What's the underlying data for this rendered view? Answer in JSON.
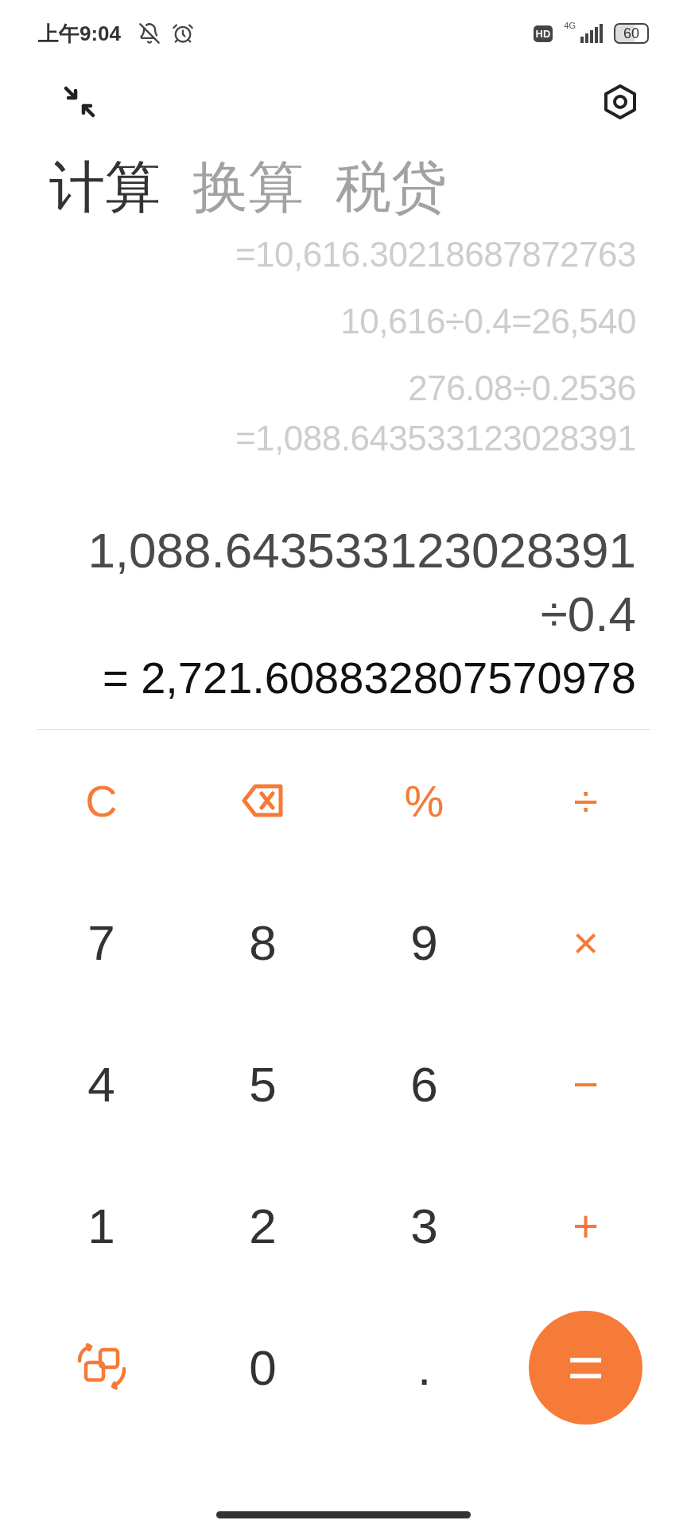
{
  "status_bar": {
    "time": "上午9:04",
    "hd_badge": "HD",
    "network": "4G",
    "battery": "60"
  },
  "tabs": [
    {
      "label": "计算",
      "selected": true
    },
    {
      "label": "换算",
      "selected": false
    },
    {
      "label": "税贷",
      "selected": false
    }
  ],
  "history": [
    {
      "lines": [
        "=10,616.30218687872763"
      ]
    },
    {
      "lines": [
        "10,616÷0.4=26,540"
      ]
    },
    {
      "lines": [
        "276.08÷0.2536",
        "=1,088.643533123028391"
      ]
    }
  ],
  "expression": [
    "1,088.643533123028391",
    "÷0.4"
  ],
  "result": "= 2,721.608832807570978",
  "keys": [
    {
      "kind": "clear",
      "label": "C"
    },
    {
      "kind": "backspace"
    },
    {
      "kind": "operator",
      "label": "%"
    },
    {
      "kind": "operator",
      "label": "÷"
    },
    {
      "kind": "digit",
      "label": "7"
    },
    {
      "kind": "digit",
      "label": "8"
    },
    {
      "kind": "digit",
      "label": "9"
    },
    {
      "kind": "operator",
      "label": "×"
    },
    {
      "kind": "digit",
      "label": "4"
    },
    {
      "kind": "digit",
      "label": "5"
    },
    {
      "kind": "digit",
      "label": "6"
    },
    {
      "kind": "operator",
      "label": "−"
    },
    {
      "kind": "digit",
      "label": "1"
    },
    {
      "kind": "digit",
      "label": "2"
    },
    {
      "kind": "digit",
      "label": "3"
    },
    {
      "kind": "operator",
      "label": "+"
    },
    {
      "kind": "swap"
    },
    {
      "kind": "digit",
      "label": "0"
    },
    {
      "kind": "digit",
      "label": "."
    },
    {
      "kind": "equals",
      "label": "="
    }
  ]
}
